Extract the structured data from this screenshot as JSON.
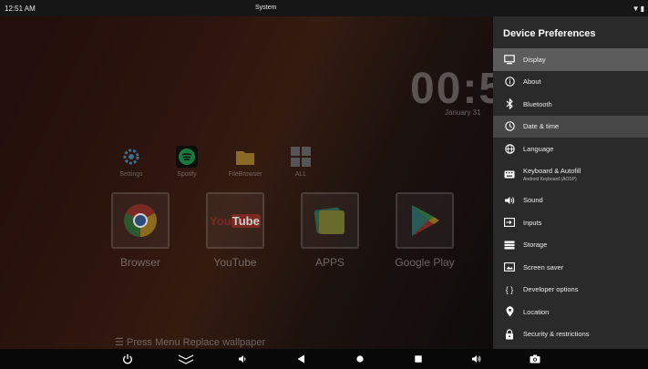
{
  "status_bar": {
    "time": "12:51 AM",
    "title": "System",
    "wifi_icon": "wifi-icon",
    "battery_icon": "battery-icon"
  },
  "launcher": {
    "clock": "00:5",
    "date": "January 31",
    "small_apps": [
      {
        "label": "Settings",
        "icon": "settings-icon"
      },
      {
        "label": "Spotify",
        "icon": "spotify-icon"
      },
      {
        "label": "FileBrowser",
        "icon": "folder-icon"
      },
      {
        "label": "ALL",
        "icon": "grid-icon"
      }
    ],
    "big_apps": [
      {
        "label": "Browser",
        "icon": "chrome-icon"
      },
      {
        "label": "YouTube",
        "icon": "youtube-icon",
        "logo_text_a": "You",
        "logo_text_b": "Tube"
      },
      {
        "label": "APPS",
        "icon": "apps-icon"
      },
      {
        "label": "Google Play",
        "icon": "play-store-icon"
      }
    ],
    "hint": "Press Menu Replace wallpaper"
  },
  "panel": {
    "title": "Device Preferences",
    "items": [
      {
        "label": "Display",
        "icon": "display-icon"
      },
      {
        "label": "About",
        "icon": "info-icon"
      },
      {
        "label": "Bluetooth",
        "icon": "bluetooth-icon"
      },
      {
        "label": "Date & time",
        "icon": "clock-icon"
      },
      {
        "label": "Language",
        "icon": "globe-icon"
      },
      {
        "label": "Keyboard & Autofill",
        "sublabel": "Android Keyboard (AOSP)",
        "icon": "keyboard-icon"
      },
      {
        "label": "Sound",
        "icon": "speaker-icon"
      },
      {
        "label": "Inputs",
        "icon": "input-icon"
      },
      {
        "label": "Storage",
        "icon": "storage-icon"
      },
      {
        "label": "Screen saver",
        "icon": "screensaver-icon"
      },
      {
        "label": "Developer options",
        "icon": "braces-icon"
      },
      {
        "label": "Location",
        "icon": "location-icon"
      },
      {
        "label": "Security & restrictions",
        "icon": "lock-icon"
      }
    ]
  },
  "nav_bar": {
    "buttons": [
      "power-icon",
      "chevron-down-icon",
      "volume-down-icon",
      "back-icon",
      "home-icon",
      "recents-icon",
      "volume-up-icon",
      "screenshot-icon"
    ]
  },
  "colors": {
    "panel_bg": "#2a2a2a",
    "selected_bg": "#5c5c5c",
    "focused_bg": "#474747"
  }
}
